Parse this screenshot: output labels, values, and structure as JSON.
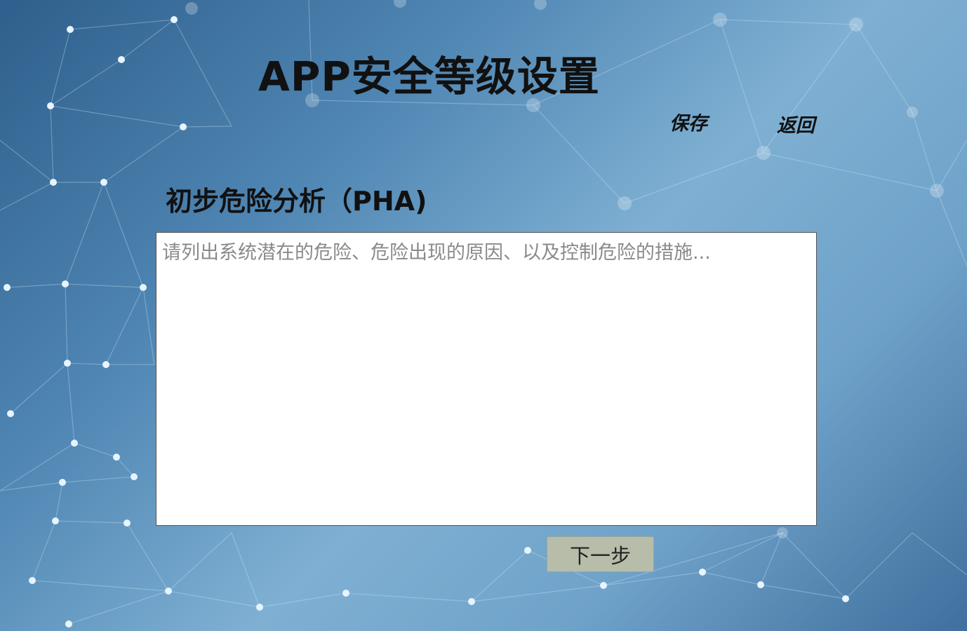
{
  "page": {
    "title": "APP安全等级设置",
    "background_theme": "network-nodes",
    "accent_color": "#5f95c0"
  },
  "toolbar": {
    "save_label": "保存",
    "back_label": "返回"
  },
  "section": {
    "title": "初步危险分析（PHA)"
  },
  "pha_input": {
    "value": "",
    "placeholder": "请列出系统潜在的危险、危险出现的原因、以及控制危险的措施..."
  },
  "next_button": {
    "label": "下一步"
  }
}
